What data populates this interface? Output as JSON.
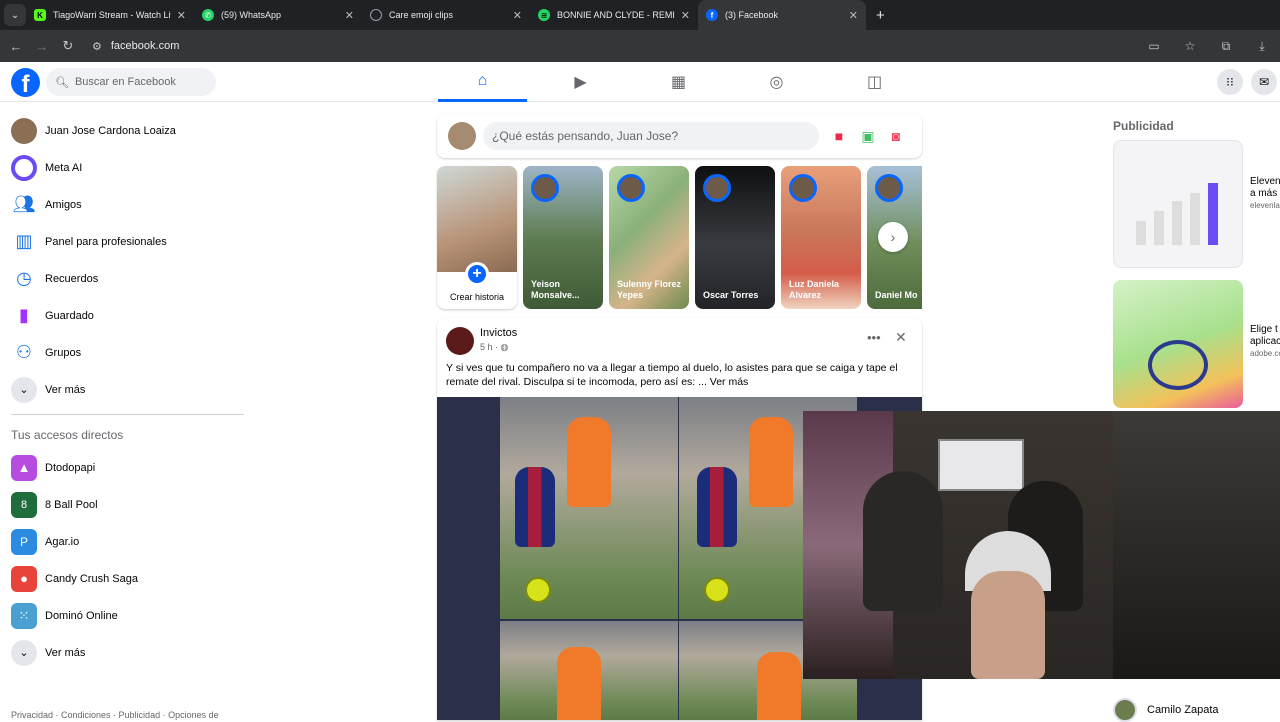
{
  "browser": {
    "tabs": [
      {
        "title": "TiagoWarri Stream - Watch Live",
        "icon": "kick-icon",
        "color": "#53fc18"
      },
      {
        "title": "(59) WhatsApp",
        "icon": "whatsapp-icon",
        "color": "#25d366"
      },
      {
        "title": "Care emoji clips",
        "icon": "globe-icon",
        "color": "#9aa0a6"
      },
      {
        "title": "BONNIE AND CLYDE - REMIX",
        "icon": "spotify-icon",
        "color": "#1ed760"
      },
      {
        "title": "(3) Facebook",
        "icon": "facebook-icon",
        "color": "#0866ff"
      }
    ],
    "url": "facebook.com"
  },
  "header": {
    "search_placeholder": "Buscar en Facebook",
    "nav": [
      "home-icon",
      "video-icon",
      "marketplace-icon",
      "groups-icon",
      "gaming-icon"
    ]
  },
  "leftnav": {
    "items": [
      {
        "label": "Juan Jose Cardona Loaiza",
        "icon": "profile-avatar",
        "color": "#8a6f55"
      },
      {
        "label": "Meta AI",
        "icon": "meta-ai-icon",
        "color": "#6c4cf5"
      },
      {
        "label": "Amigos",
        "icon": "friends-icon",
        "color": "#1b74e4"
      },
      {
        "label": "Panel para profesionales",
        "icon": "dashboard-icon",
        "color": "#1b74e4"
      },
      {
        "label": "Recuerdos",
        "icon": "memories-icon",
        "color": "#1b74e4"
      },
      {
        "label": "Guardado",
        "icon": "bookmark-icon",
        "color": "#a033ff"
      },
      {
        "label": "Grupos",
        "icon": "groups-icon",
        "color": "#1b74e4"
      },
      {
        "label": "Ver más",
        "icon": "chevron-down-icon",
        "color": "#e4e6eb"
      }
    ],
    "shortcuts_title": "Tus accesos directos",
    "shortcuts": [
      {
        "label": "Dtodopapi",
        "icon": "dtodopapi-icon",
        "color": "#b64ce0"
      },
      {
        "label": "8 Ball Pool",
        "icon": "8-ball-pool-icon",
        "color": "#1f6d3a"
      },
      {
        "label": "Agar.io",
        "icon": "agario-icon",
        "color": "#2a8be0"
      },
      {
        "label": "Candy Crush Saga",
        "icon": "candy-crush-icon",
        "color": "#e8433a"
      },
      {
        "label": "Dominó Online",
        "icon": "domino-icon",
        "color": "#4aa0d0"
      },
      {
        "label": "Ver más",
        "icon": "chevron-down-icon",
        "color": "#e4e6eb"
      }
    ],
    "footer": "Privacidad · Condiciones · Publicidad · Opciones de"
  },
  "composer": {
    "placeholder": "¿Qué estás pensando, Juan Jose?"
  },
  "stories": {
    "create_label": "Crear historia",
    "items": [
      {
        "name": "Yeison Monsalve...",
        "bg": "#5f7d52"
      },
      {
        "name": "Sulenny Florez Yepes",
        "bg": "#8ab07a"
      },
      {
        "name": "Oscar Torres",
        "bg": "#222428"
      },
      {
        "name": "Luz Daniela Alvarez",
        "bg": "#c9785a"
      },
      {
        "name": "Daniel Monsalve R",
        "bg": "#6e8e5a"
      }
    ]
  },
  "post": {
    "author": "Invictos",
    "time": "5 h ·",
    "text": "Y si ves que tu compañero no va a llegar a tiempo al duelo, lo asistes para que se caiga y tape el remate del rival. Disculpa si te incomoda, pero así es: ...",
    "see_more": "Ver más"
  },
  "right": {
    "ads_title": "Publicidad",
    "ads": [
      {
        "title": "ElevenLabs",
        "domain": "elevenlabs.io",
        "line": "a más de cre"
      },
      {
        "title": "Elige t",
        "domain": "adobe.com",
        "line": "aplicac"
      }
    ],
    "contact": "Camilo Zapata"
  }
}
